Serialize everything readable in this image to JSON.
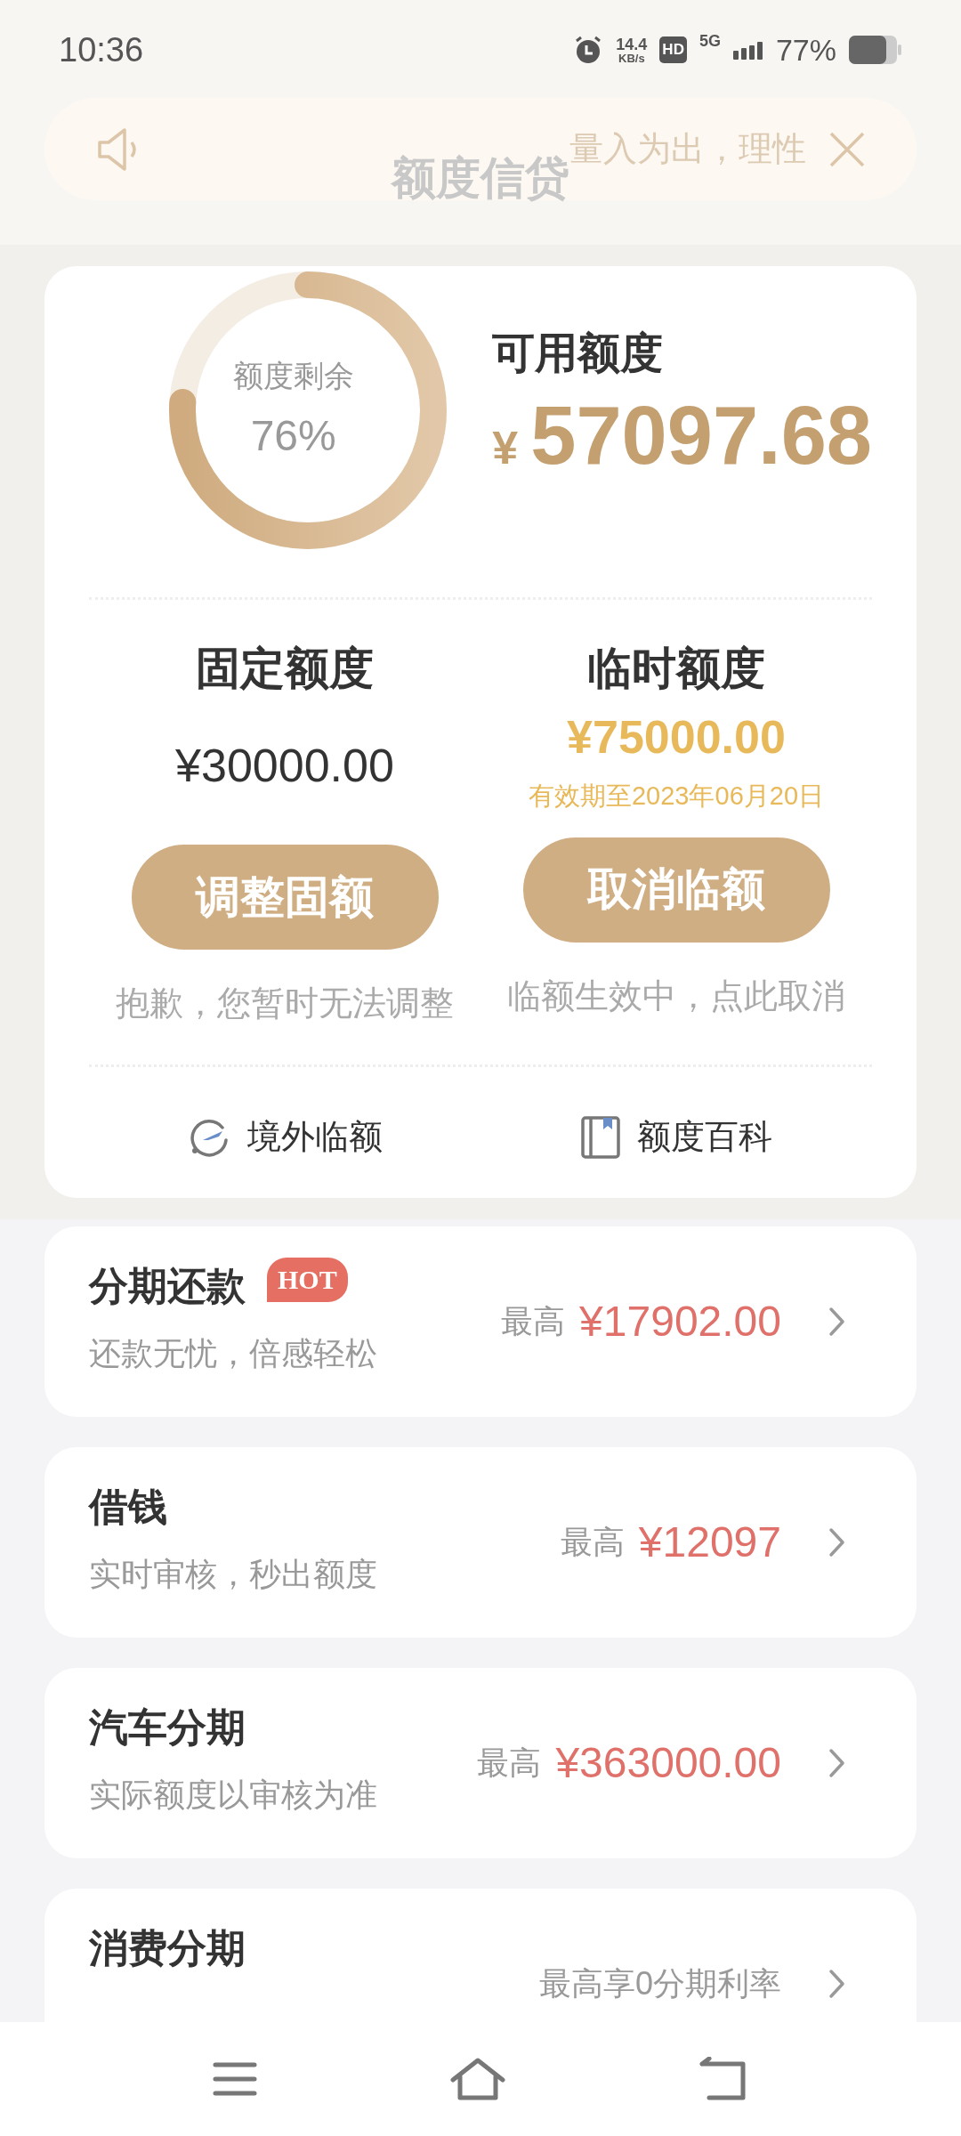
{
  "status_bar": {
    "time": "10:36",
    "net_speed": "14.4",
    "net_unit": "KB/s",
    "hd": "HD",
    "network": "5G",
    "battery": "77%"
  },
  "header": {
    "title": "额度信贷",
    "notice": "量入为出，理性"
  },
  "credit": {
    "ring_label": "额度剩余",
    "ring_value": "76%",
    "available_label": "可用额度",
    "currency": "¥",
    "available": "57097.68"
  },
  "quotas": [
    {
      "title": "固定额度",
      "amount": "¥30000.00",
      "kind": "fixed",
      "button": "调整固额",
      "note": "抱歉，您暂时无法调整"
    },
    {
      "title": "临时额度",
      "amount": "¥75000.00",
      "kind": "temporary",
      "expiry": "有效期至2023年06月20日",
      "button": "取消临额",
      "note": "临额生效中，点此取消"
    }
  ],
  "links": [
    {
      "label": "境外临额",
      "kind": "plane"
    },
    {
      "label": "额度百科",
      "kind": "book"
    }
  ],
  "products": [
    {
      "title": "分期还款",
      "badge": "HOT",
      "subtitle": "还款无忧，倍感轻松",
      "prefix": "最高",
      "amount": "¥17902.00"
    },
    {
      "title": "借钱",
      "subtitle": "实时审核，秒出额度",
      "prefix": "最高",
      "amount": "¥12097"
    },
    {
      "title": "汽车分期",
      "subtitle": "实际额度以审核为准",
      "prefix": "最高",
      "amount": "¥363000.00"
    },
    {
      "title": "消费分期",
      "prefix": "最高享0分期利率"
    }
  ]
}
